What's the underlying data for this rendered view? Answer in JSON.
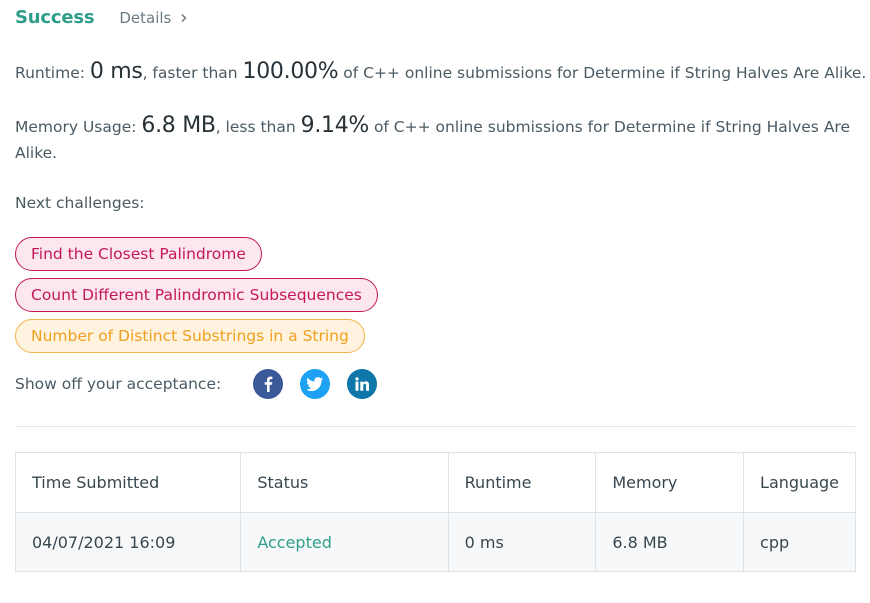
{
  "header": {
    "status": "Success",
    "details_label": "Details"
  },
  "runtime": {
    "label": "Runtime: ",
    "value": "0 ms",
    "compare_text": ", faster than ",
    "percent": "100.00%",
    "suffix": " of C++ online submissions for Determine if String Halves Are Alike."
  },
  "memory": {
    "label": "Memory Usage: ",
    "value": "6.8 MB",
    "compare_text": ", less than ",
    "percent": "9.14%",
    "suffix": " of C++ online submissions for Determine if String Halves Are Alike."
  },
  "next_challenges": {
    "label": "Next challenges:",
    "items": [
      {
        "label": "Find the Closest Palindrome",
        "difficulty": "hard"
      },
      {
        "label": "Count Different Palindromic Subsequences",
        "difficulty": "hard"
      },
      {
        "label": "Number of Distinct Substrings in a String",
        "difficulty": "medium"
      }
    ]
  },
  "share": {
    "label": "Show off your acceptance:",
    "icons": [
      "facebook-icon",
      "twitter-icon",
      "linkedin-icon"
    ]
  },
  "table": {
    "columns": [
      "Time Submitted",
      "Status",
      "Runtime",
      "Memory",
      "Language"
    ],
    "rows": [
      [
        "04/07/2021 16:09",
        "Accepted",
        "0 ms",
        "6.8 MB",
        "cpp"
      ]
    ]
  },
  "colors": {
    "success": "#2e9e8a",
    "hard": "#c2185b",
    "medium": "#f0a020",
    "facebook": "#3b5998",
    "twitter": "#1da1f2",
    "linkedin": "#0e76a8"
  }
}
